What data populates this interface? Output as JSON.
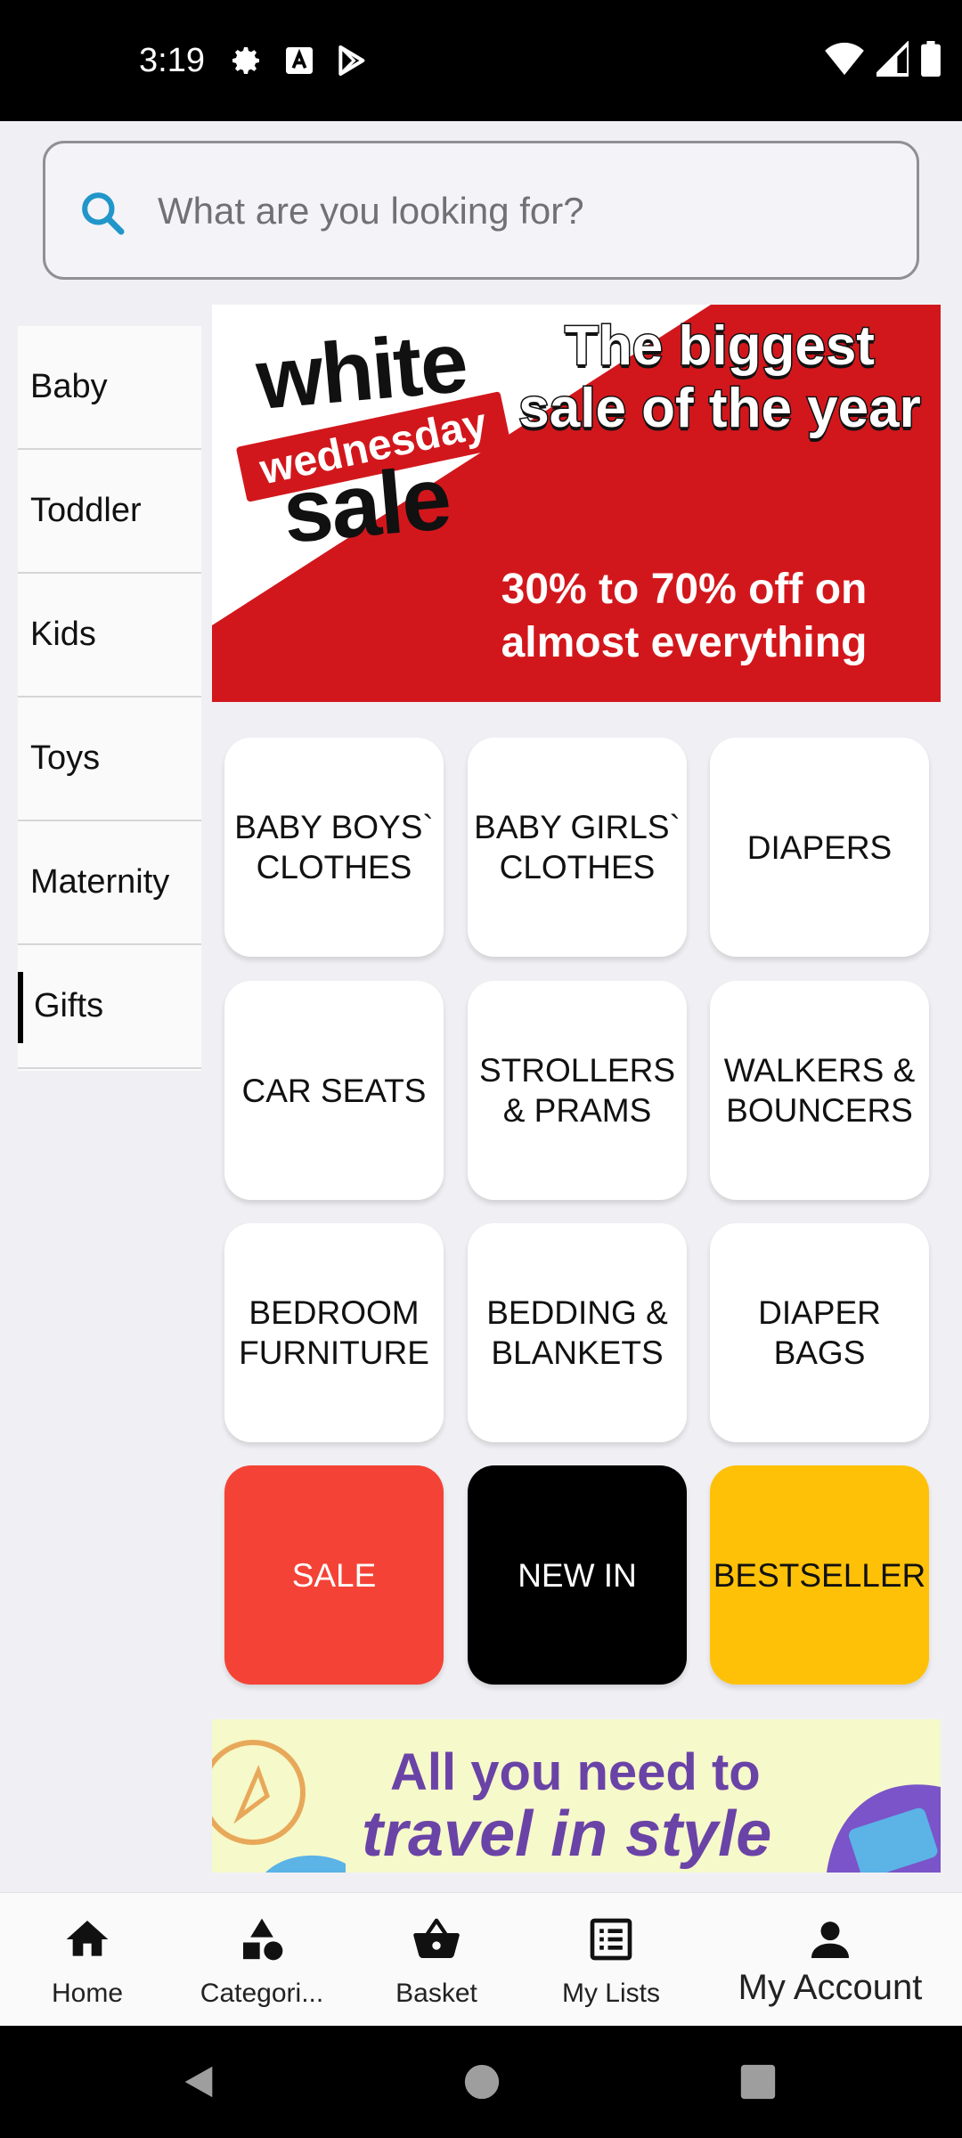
{
  "status_bar": {
    "time": "3:19",
    "left_icons": [
      "gear-icon",
      "font-a-icon",
      "play-store-icon"
    ],
    "right_icons": [
      "wifi-icon",
      "signal-icon",
      "battery-icon"
    ]
  },
  "search": {
    "placeholder": "What are you looking for?",
    "value": ""
  },
  "sidebar": {
    "items": [
      {
        "label": "Baby"
      },
      {
        "label": "Toddler"
      },
      {
        "label": "Kids"
      },
      {
        "label": "Toys"
      },
      {
        "label": "Maternity"
      },
      {
        "label": "Gifts"
      }
    ],
    "active": "Gifts"
  },
  "hero_banner": {
    "brand_line1": "white",
    "brand_line2": "wednesday",
    "brand_line3": "sale",
    "headline": "The biggest sale of the year",
    "subtext": "30% to 70% off on almost everything",
    "color": "#d2171c"
  },
  "categories": {
    "row1": [
      "BABY BOYS` CLOTHES",
      "BABY GIRLS` CLOTHES",
      "DIAPERS"
    ],
    "row2": [
      "CAR SEATS",
      "STROLLERS & PRAMS",
      "WALKERS & BOUNCERS"
    ],
    "row3": [
      "BEDROOM FURNITURE",
      "BEDDING & BLANKETS",
      "DIAPER BAGS"
    ],
    "row4": [
      "SALE",
      "NEW IN",
      "BESTSELLER"
    ]
  },
  "tile_colors": {
    "sale": "#f44336",
    "new_in": "#000000",
    "bestseller": "#ffc107"
  },
  "promo_banner": {
    "line1": "All you need to",
    "line2": "travel in style"
  },
  "bottom_nav": {
    "items": [
      {
        "label": "Home",
        "icon": "home-icon"
      },
      {
        "label": "Categori...",
        "icon": "categories-icon"
      },
      {
        "label": "Basket",
        "icon": "basket-icon"
      },
      {
        "label": "My Lists",
        "icon": "list-icon"
      },
      {
        "label": "My Account",
        "icon": "account-icon"
      }
    ]
  }
}
